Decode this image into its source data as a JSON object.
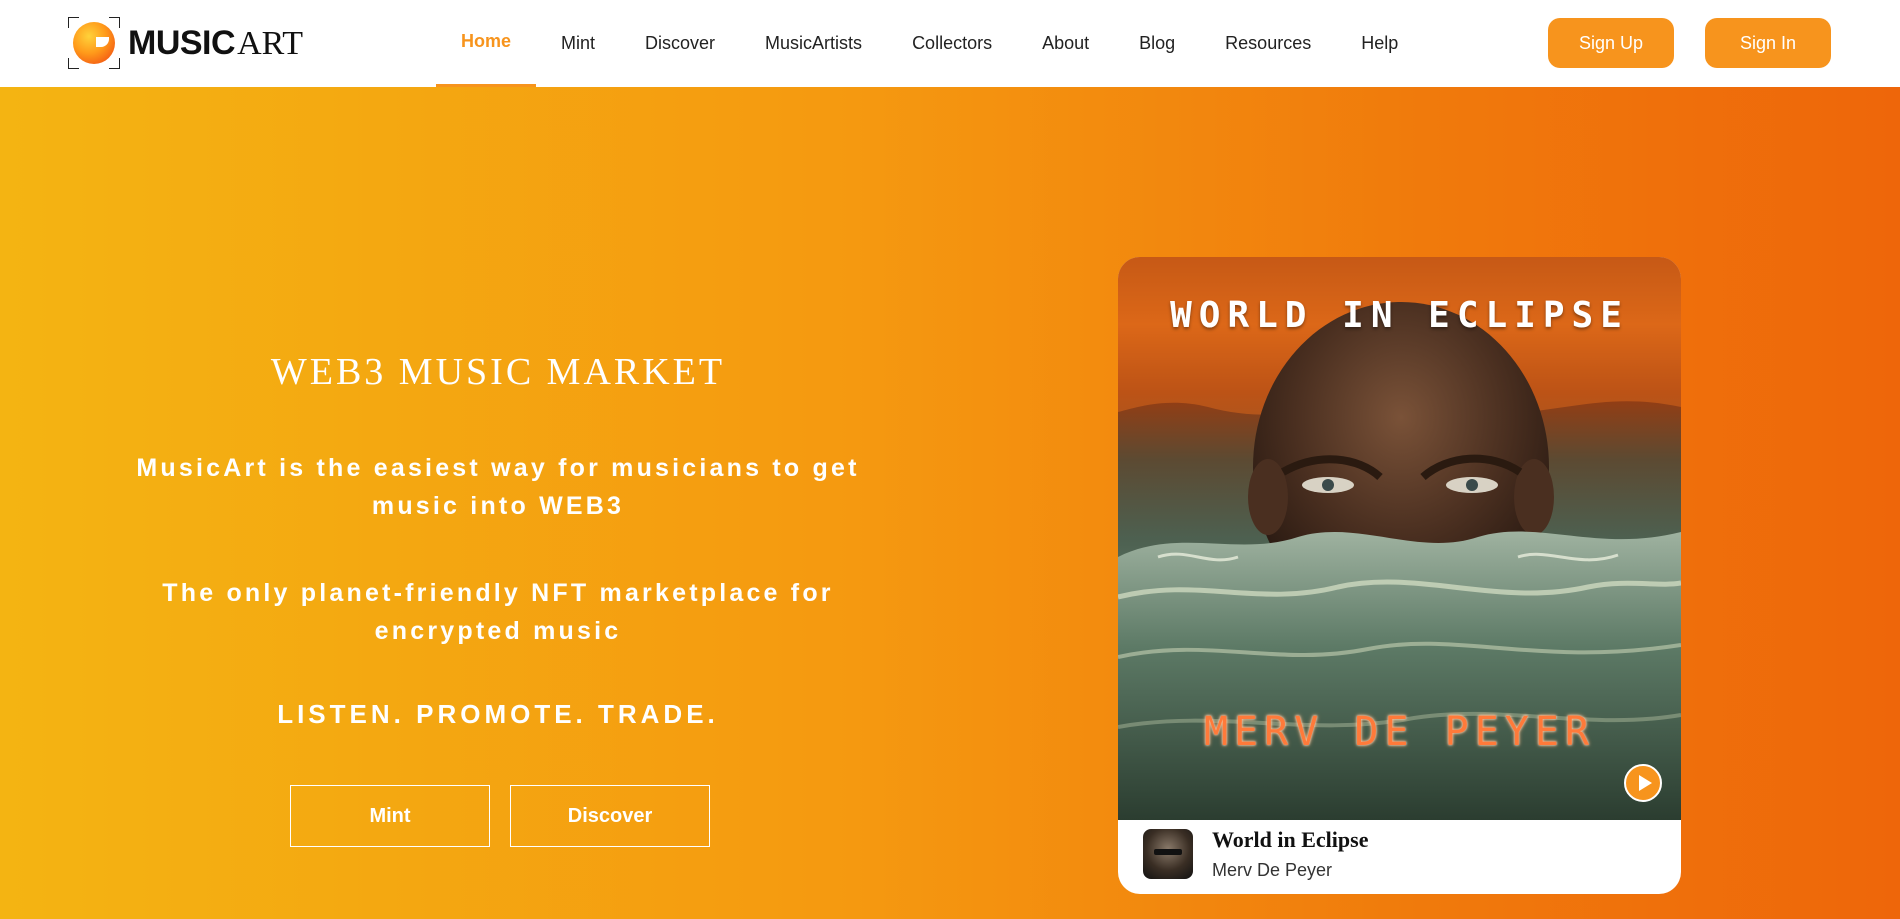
{
  "brand": {
    "name_bold": "MUSIC",
    "name_light": "ART"
  },
  "nav": {
    "items": [
      {
        "label": "Home",
        "active": true
      },
      {
        "label": "Mint"
      },
      {
        "label": "Discover"
      },
      {
        "label": "MusicArtists"
      },
      {
        "label": "Collectors"
      },
      {
        "label": "About"
      },
      {
        "label": "Blog"
      },
      {
        "label": "Resources"
      },
      {
        "label": "Help"
      }
    ],
    "signup_label": "Sign Up",
    "signin_label": "Sign In"
  },
  "hero": {
    "title": "WEB3 MUSIC MARKET",
    "subtitle1": "MusicArt is the easiest way for musicians to get music into WEB3",
    "subtitle2": "The only planet-friendly NFT marketplace for encrypted music",
    "tagline": "LISTEN. PROMOTE. TRADE.",
    "mint_label": "Mint",
    "discover_label": "Discover"
  },
  "featured": {
    "cover_title": "WORLD IN ECLIPSE",
    "cover_artist": "MERV DE PEYER",
    "song_title": "World in Eclipse",
    "artist": "Merv De Peyer"
  },
  "colors": {
    "accent": "#f7941d",
    "gradient_start": "#f4b412",
    "gradient_end": "#ee660a"
  },
  "icons": {
    "logo": "music-disc-logo-icon",
    "play": "play-icon"
  }
}
